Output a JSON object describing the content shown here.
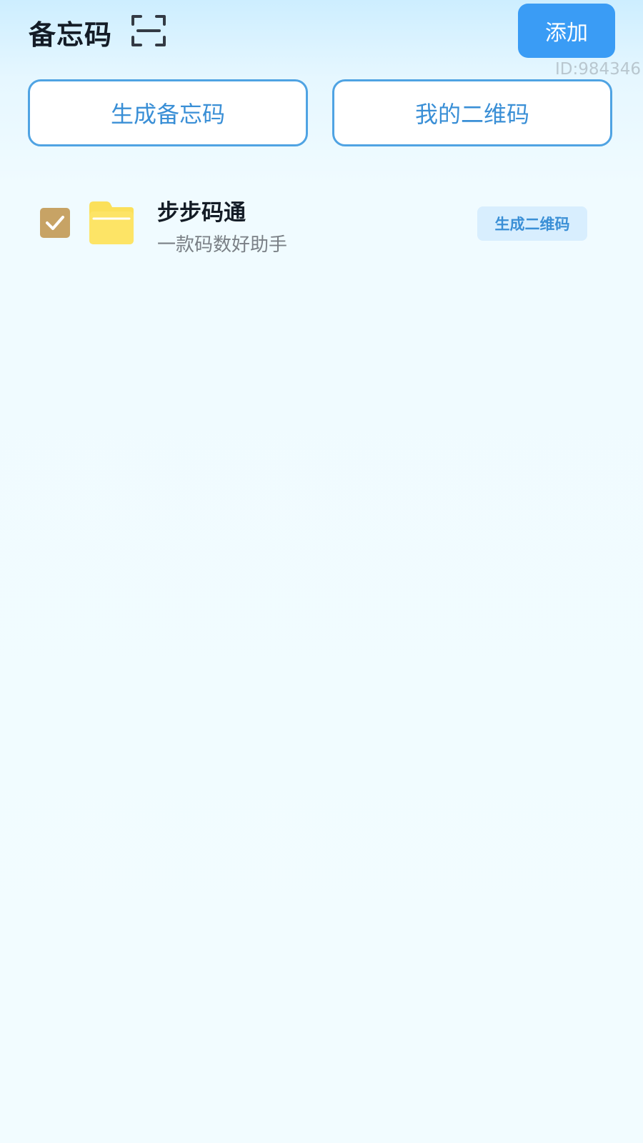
{
  "header": {
    "title": "备忘码",
    "scan_icon": "scan-icon",
    "add_label": "添加",
    "id_text": "ID:984346"
  },
  "actions": {
    "generate_label": "生成备忘码",
    "my_qr_label": "我的二维码"
  },
  "list": {
    "items": [
      {
        "title": "步步码通",
        "subtitle": "一款码数好助手",
        "checked": true,
        "icon": "folder-icon",
        "action_label": "生成二维码"
      }
    ]
  },
  "colors": {
    "accent": "#3a9cf5",
    "outline": "#4fa3e3",
    "checkbox": "#c7a365",
    "folder": "#fbe05a"
  }
}
